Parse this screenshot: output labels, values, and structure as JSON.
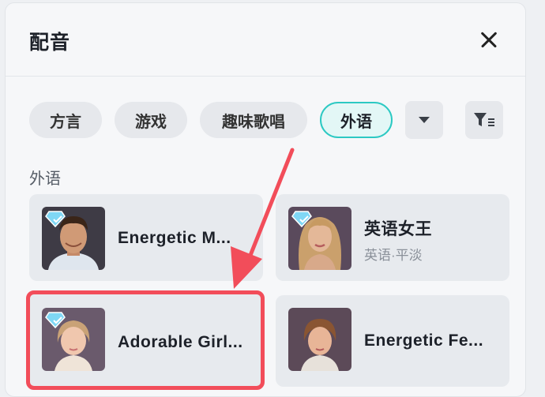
{
  "dialog": {
    "title": "配音"
  },
  "tabs": [
    {
      "label": "方言",
      "active": false
    },
    {
      "label": "游戏",
      "active": false
    },
    {
      "label": "趣味歌唱",
      "active": false
    },
    {
      "label": "外语",
      "active": true
    }
  ],
  "icons": {
    "dropdown": "caret-down-icon",
    "filter": "filter-icon",
    "close": "close-icon",
    "premium": "diamond-icon"
  },
  "section": {
    "label": "外语"
  },
  "voices": [
    {
      "name": "Energetic M...",
      "subtitle": "",
      "premium": true
    },
    {
      "name": "英语女王",
      "subtitle": "英语·平淡",
      "premium": true
    },
    {
      "name": "Adorable Girl...",
      "subtitle": "",
      "premium": true,
      "highlighted": true
    },
    {
      "name": "Energetic Fe...",
      "subtitle": "",
      "premium": false
    }
  ],
  "colors": {
    "accent": "#2cc9c3",
    "highlight": "#f24d5a",
    "chip_bg": "#e6e8ec"
  }
}
